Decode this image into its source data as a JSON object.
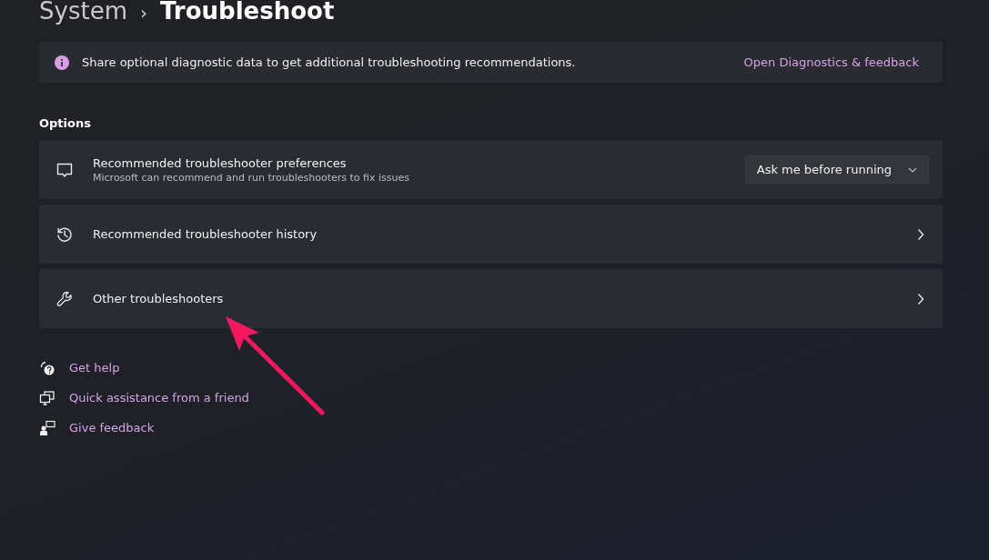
{
  "breadcrumb": {
    "parent": "System",
    "separator": "›",
    "current": "Troubleshoot"
  },
  "banner": {
    "text": "Share optional diagnostic data to get additional troubleshooting recommendations.",
    "link": "Open Diagnostics & feedback"
  },
  "section_label": "Options",
  "options": [
    {
      "kind": "dropdown",
      "title": "Recommended troubleshooter preferences",
      "subtitle": "Microsoft can recommend and run troubleshooters to fix issues",
      "value": "Ask me before running"
    },
    {
      "kind": "link",
      "title": "Recommended troubleshooter history"
    },
    {
      "kind": "link",
      "title": "Other troubleshooters"
    }
  ],
  "help_links": [
    {
      "label": "Get help"
    },
    {
      "label": "Quick assistance from a friend"
    },
    {
      "label": "Give feedback"
    }
  ]
}
